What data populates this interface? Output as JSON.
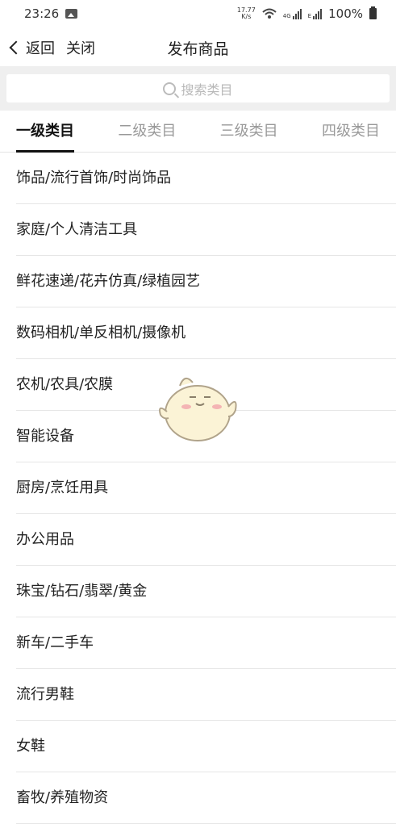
{
  "status_bar": {
    "time": "23:26",
    "net_speed_top": "17.77",
    "net_speed_bottom": "K/s",
    "signal_label_1": "4G",
    "signal_label_2": "E",
    "battery_text": "100%",
    "icons": [
      "image-icon",
      "wifi-icon",
      "signal-icon",
      "battery-icon"
    ]
  },
  "navbar": {
    "back_label": "返回",
    "close_label": "关闭",
    "title": "发布商品"
  },
  "search": {
    "placeholder": "搜索类目"
  },
  "tabs": [
    {
      "label": "一级类目",
      "active": true
    },
    {
      "label": "二级类目",
      "active": false
    },
    {
      "label": "三级类目",
      "active": false
    },
    {
      "label": "四级类目",
      "active": false
    }
  ],
  "categories": [
    "饰品/流行首饰/时尚饰品",
    "家庭/个人清洁工具",
    "鲜花速递/花卉仿真/绿植园艺",
    "数码相机/单反相机/摄像机",
    "农机/农具/农膜",
    "智能设备",
    "厨房/烹饪用具",
    "办公用品",
    "珠宝/钻石/翡翠/黄金",
    "新车/二手车",
    "流行男鞋",
    "女鞋",
    "畜牧/养殖物资"
  ]
}
